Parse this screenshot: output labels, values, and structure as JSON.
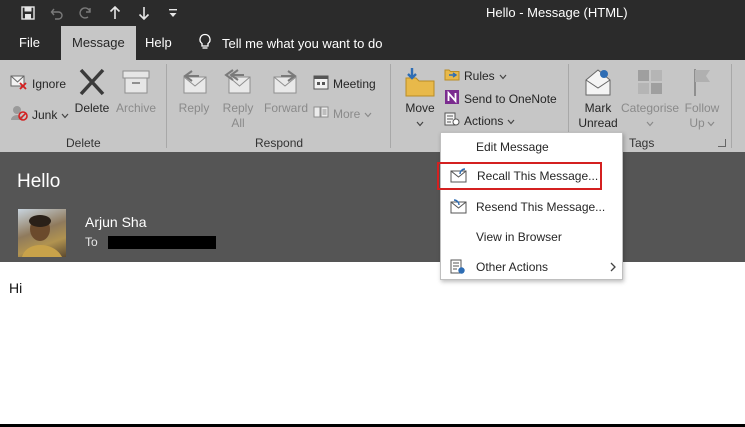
{
  "window": {
    "title": "Hello  -  Message (HTML)"
  },
  "quick_access": [
    {
      "icon": "save-icon"
    },
    {
      "icon": "undo-icon"
    },
    {
      "icon": "redo-icon"
    },
    {
      "icon": "up-arrow-icon"
    },
    {
      "icon": "down-arrow-icon"
    },
    {
      "icon": "customize-icon"
    }
  ],
  "menu": {
    "tabs": [
      {
        "label": "File"
      },
      {
        "label": "Message",
        "active": true
      },
      {
        "label": "Help"
      }
    ],
    "tell_me": "Tell me what you want to do"
  },
  "ribbon": {
    "delete": {
      "ignore": "Ignore",
      "junk": "Junk",
      "delete": "Delete",
      "archive": "Archive",
      "group_label": "Delete"
    },
    "respond": {
      "reply": "Reply",
      "reply_all_1": "Reply",
      "reply_all_2": "All",
      "forward": "Forward",
      "meeting": "Meeting",
      "more": "More",
      "group_label": "Respond"
    },
    "move": {
      "move": "Move",
      "rules": "Rules",
      "onenote": "Send to OneNote",
      "actions": "Actions"
    },
    "tags": {
      "mark_unread_1": "Mark",
      "mark_unread_2": "Unread",
      "categorise": "Categorise",
      "follow_up_1": "Follow",
      "follow_up_2": "Up",
      "group_label": "Tags"
    }
  },
  "message": {
    "subject": "Hello",
    "sender": "Arjun Sha",
    "to_label": "To",
    "body": "Hi"
  },
  "actions_menu": [
    {
      "label": "Edit Message"
    },
    {
      "label": "Recall This Message...",
      "highlighted": true
    },
    {
      "label": "Resend This Message..."
    },
    {
      "label": "View in Browser"
    },
    {
      "label": "Other Actions"
    }
  ],
  "colors": {
    "title_bar": "#2b2b2b",
    "ribbon": "#c6c6c6",
    "reading_header": "#555555",
    "highlight_border": "#d42020",
    "onenote_purple": "#7b2c8f"
  }
}
